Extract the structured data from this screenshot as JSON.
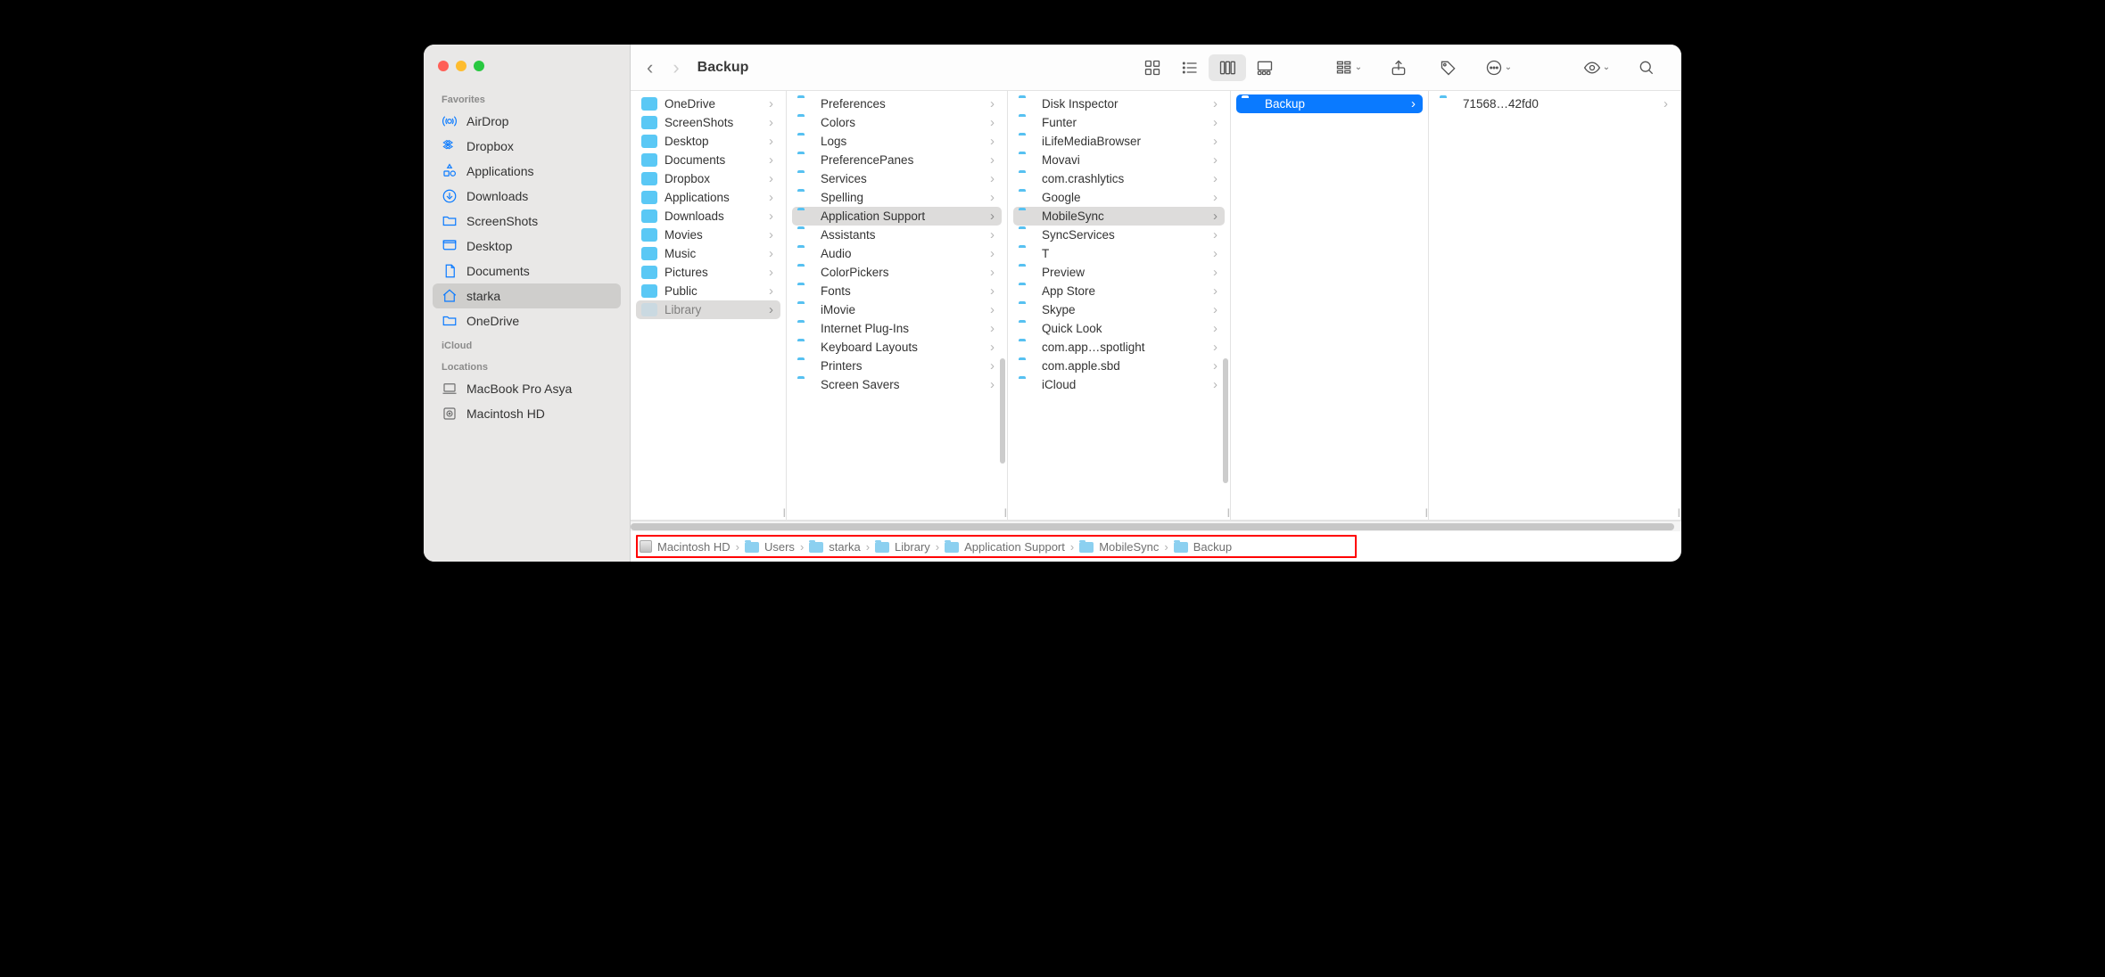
{
  "window": {
    "title": "Backup"
  },
  "sidebar": {
    "sections": [
      {
        "heading": "Favorites",
        "items": [
          {
            "label": "AirDrop",
            "icon": "airdrop"
          },
          {
            "label": "Dropbox",
            "icon": "dropbox"
          },
          {
            "label": "Applications",
            "icon": "apps"
          },
          {
            "label": "Downloads",
            "icon": "downloads"
          },
          {
            "label": "ScreenShots",
            "icon": "folder"
          },
          {
            "label": "Desktop",
            "icon": "desktop"
          },
          {
            "label": "Documents",
            "icon": "documents"
          },
          {
            "label": "starka",
            "icon": "home",
            "selected": true
          },
          {
            "label": "OneDrive",
            "icon": "folder"
          }
        ]
      },
      {
        "heading": "iCloud",
        "items": []
      },
      {
        "heading": "Locations",
        "items": [
          {
            "label": "MacBook Pro Asya",
            "icon": "laptop"
          },
          {
            "label": "Macintosh HD",
            "icon": "disk"
          }
        ]
      }
    ]
  },
  "columns": [
    {
      "width": "c1",
      "items": [
        {
          "label": "OneDrive",
          "icon": "onedrive",
          "chev": true
        },
        {
          "label": "ScreenShots",
          "icon": "screenshots",
          "chev": true
        },
        {
          "label": "Desktop",
          "icon": "desktop",
          "chev": true
        },
        {
          "label": "Documents",
          "icon": "docs",
          "chev": true
        },
        {
          "label": "Dropbox",
          "icon": "dropbox",
          "chev": true
        },
        {
          "label": "Applications",
          "icon": "apps",
          "chev": true
        },
        {
          "label": "Downloads",
          "icon": "down",
          "chev": true
        },
        {
          "label": "Movies",
          "icon": "movie",
          "chev": true
        },
        {
          "label": "Music",
          "icon": "music",
          "chev": true
        },
        {
          "label": "Pictures",
          "icon": "pic",
          "chev": true
        },
        {
          "label": "Public",
          "icon": "pub",
          "chev": true
        },
        {
          "label": "Library",
          "icon": "lib",
          "chev": true,
          "pathSel": true,
          "dim": true
        }
      ]
    },
    {
      "width": "c2",
      "items": [
        {
          "label": "Preferences",
          "icon": "folder",
          "chev": true
        },
        {
          "label": "Colors",
          "icon": "folder",
          "chev": true
        },
        {
          "label": "Logs",
          "icon": "folder",
          "chev": true
        },
        {
          "label": "PreferencePanes",
          "icon": "folder",
          "chev": true
        },
        {
          "label": "Services",
          "icon": "folder",
          "chev": true
        },
        {
          "label": "Spelling",
          "icon": "folder",
          "chev": true
        },
        {
          "label": "Application Support",
          "icon": "folder",
          "chev": true,
          "pathSel": true
        },
        {
          "label": "Assistants",
          "icon": "folder",
          "chev": true
        },
        {
          "label": "Audio",
          "icon": "folder",
          "chev": true
        },
        {
          "label": "ColorPickers",
          "icon": "folder",
          "chev": true
        },
        {
          "label": "Fonts",
          "icon": "folder",
          "chev": true
        },
        {
          "label": "iMovie",
          "icon": "folder",
          "chev": true
        },
        {
          "label": "Internet Plug-Ins",
          "icon": "folder",
          "chev": true
        },
        {
          "label": "Keyboard Layouts",
          "icon": "folder",
          "chev": true
        },
        {
          "label": "Printers",
          "icon": "folder",
          "chev": true
        },
        {
          "label": "Screen Savers",
          "icon": "folder",
          "chev": true
        }
      ]
    },
    {
      "width": "c3",
      "items": [
        {
          "label": "Disk Inspector",
          "icon": "folder",
          "chev": true
        },
        {
          "label": "Funter",
          "icon": "folder",
          "chev": true
        },
        {
          "label": "iLifeMediaBrowser",
          "icon": "folder",
          "chev": true
        },
        {
          "label": "Movavi",
          "icon": "folder",
          "chev": true
        },
        {
          "label": "com.crashlytics",
          "icon": "folder",
          "chev": true
        },
        {
          "label": "Google",
          "icon": "folder",
          "chev": true
        },
        {
          "label": "MobileSync",
          "icon": "folder",
          "chev": true,
          "pathSel": true
        },
        {
          "label": "SyncServices",
          "icon": "folder",
          "chev": true
        },
        {
          "label": "T",
          "icon": "folder",
          "chev": true
        },
        {
          "label": "Preview",
          "icon": "folder",
          "chev": true
        },
        {
          "label": "App Store",
          "icon": "folder",
          "chev": true
        },
        {
          "label": "Skype",
          "icon": "folder",
          "chev": true
        },
        {
          "label": "Quick Look",
          "icon": "folder",
          "chev": true
        },
        {
          "label": "com.app…spotlight",
          "icon": "folder",
          "chev": true
        },
        {
          "label": "com.apple.sbd",
          "icon": "folder",
          "chev": true
        },
        {
          "label": "iCloud",
          "icon": "folder",
          "chev": true
        }
      ]
    },
    {
      "width": "c4",
      "items": [
        {
          "label": "Backup",
          "icon": "folder",
          "chev": true,
          "active": true
        }
      ]
    },
    {
      "width": "c5",
      "items": [
        {
          "label": "71568…42fd0",
          "icon": "folder",
          "chev": true
        }
      ]
    }
  ],
  "pathbar": [
    {
      "label": "Macintosh HD",
      "icon": "hd"
    },
    {
      "label": "Users",
      "icon": "folder"
    },
    {
      "label": "starka",
      "icon": "folder"
    },
    {
      "label": "Library",
      "icon": "folder"
    },
    {
      "label": "Application Support",
      "icon": "folder"
    },
    {
      "label": "MobileSync",
      "icon": "folder"
    },
    {
      "label": "Backup",
      "icon": "folder"
    }
  ]
}
